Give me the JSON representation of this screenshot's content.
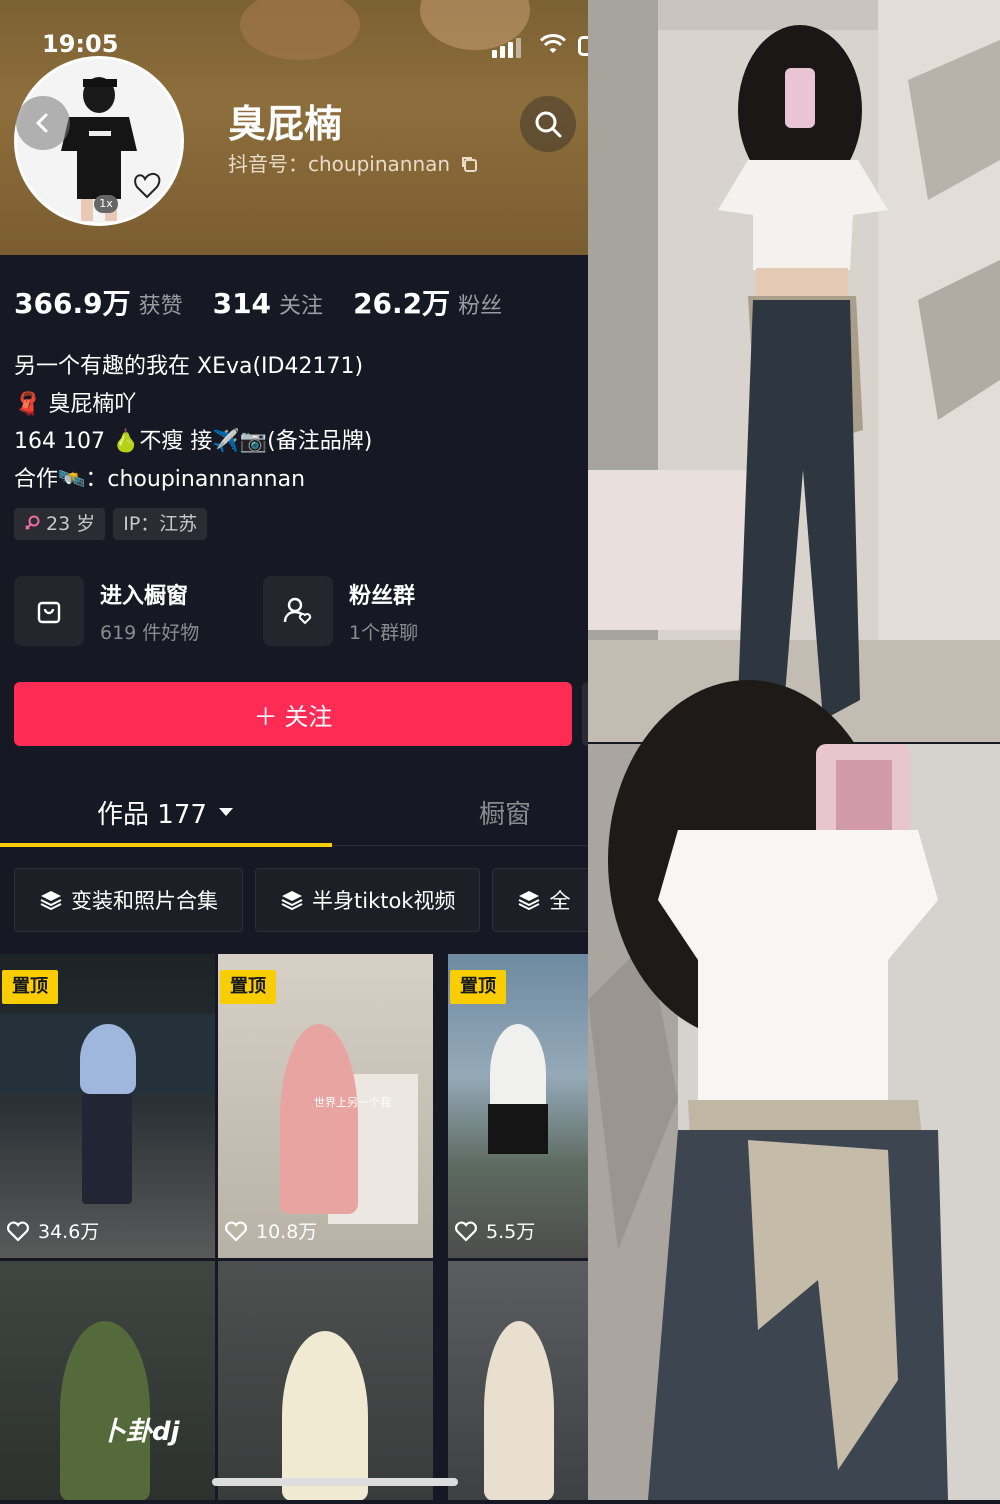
{
  "status_bar": {
    "time": "19:05"
  },
  "profile": {
    "name": "臭屁楠",
    "douyin_id": "抖音号：choupinannan",
    "avatar_speed": "1x"
  },
  "stats": [
    {
      "num": "366.9万",
      "label": "获赞"
    },
    {
      "num": "314",
      "label": "关注"
    },
    {
      "num": "26.2万",
      "label": "粉丝"
    }
  ],
  "bio": {
    "line1": "另一个有趣的我在 XEva(ID42171)",
    "line2": "🧣 臭屁楠吖",
    "line3": "164 107 🍐不瘦 接✈️📷(备注品牌)",
    "line4": "合作🛰️：choupinannannan"
  },
  "tags": {
    "age": "23 岁",
    "ip": "IP：江苏"
  },
  "tiles": {
    "shop_title": "进入橱窗",
    "shop_sub": "619 件好物",
    "fans_title": "粉丝群",
    "fans_sub": "1个群聊"
  },
  "follow_button": "＋ 关注",
  "tabs": {
    "works": "作品 177",
    "shop": "橱窗"
  },
  "chips": [
    "变装和照片合集",
    "半身tiktok视频",
    "全"
  ],
  "videos": [
    {
      "pin": "置顶",
      "likes": "34.6万"
    },
    {
      "pin": "置顶",
      "likes": "10.8万"
    },
    {
      "pin": "置顶",
      "likes": "5.5万"
    }
  ],
  "overlay_texts": {
    "v2": "世界上另一个我",
    "v4": "卜卦dj"
  },
  "colors": {
    "accent": "#fe2c55",
    "pin": "#facd00",
    "bg": "#161823",
    "header": "#8d6e3c"
  },
  "icons": [
    "back-icon",
    "search-icon",
    "copy-icon",
    "shop-bag-icon",
    "fan-group-icon",
    "layers-icon",
    "heart-icon",
    "caret-down-icon",
    "female-icon"
  ]
}
